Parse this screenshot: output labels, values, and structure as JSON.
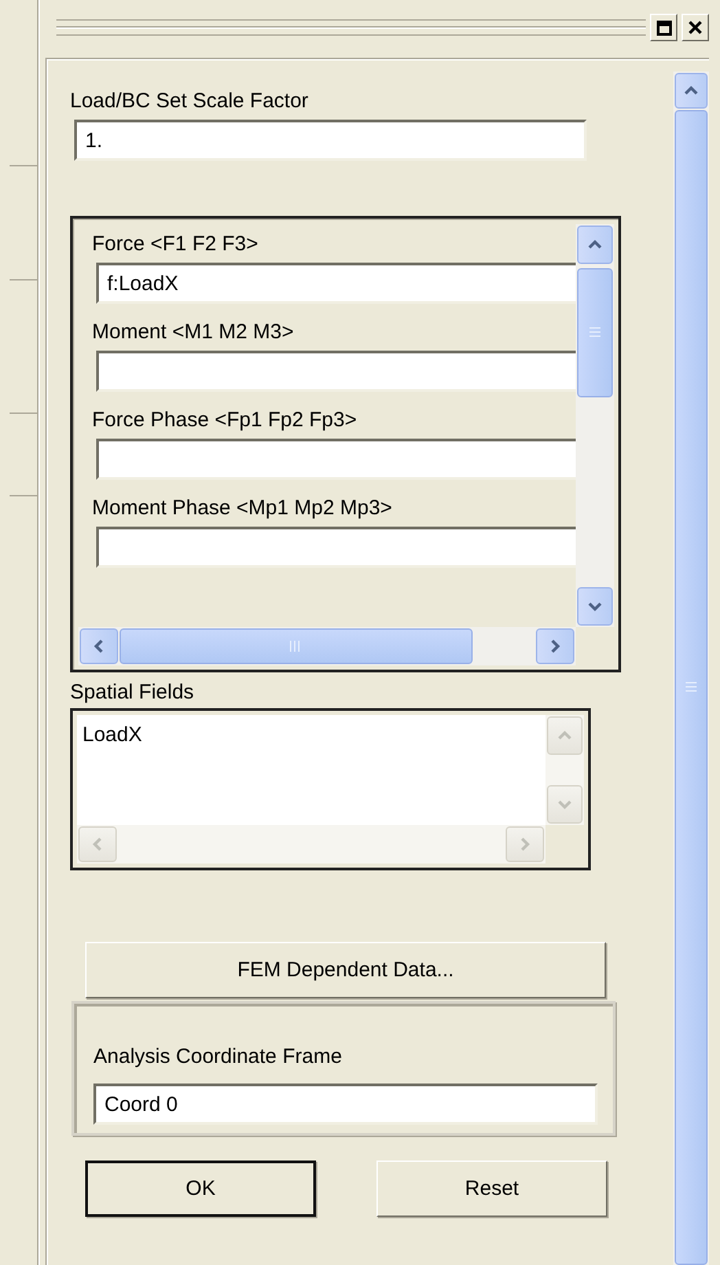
{
  "scale_factor": {
    "label": "Load/BC Set Scale Factor",
    "value": "1."
  },
  "vector_fields": [
    {
      "label": "Force <F1 F2 F3>",
      "value": "f:LoadX"
    },
    {
      "label": "Moment <M1 M2 M3>"
    },
    {
      "label": "Force Phase <Fp1 Fp2 Fp3>"
    },
    {
      "label": "Moment Phase <Mp1 Mp2 Mp3>"
    }
  ],
  "spatial_fields": {
    "label": "Spatial Fields",
    "items": [
      {
        "text": "LoadX",
        "selected": false
      }
    ]
  },
  "fem_button": {
    "label": "FEM Dependent Data..."
  },
  "coordinate_frame": {
    "label": "Analysis Coordinate Frame",
    "value": "Coord 0"
  },
  "buttons": [
    {
      "label": "OK",
      "default": true
    },
    {
      "label": "Reset",
      "default": false
    }
  ]
}
